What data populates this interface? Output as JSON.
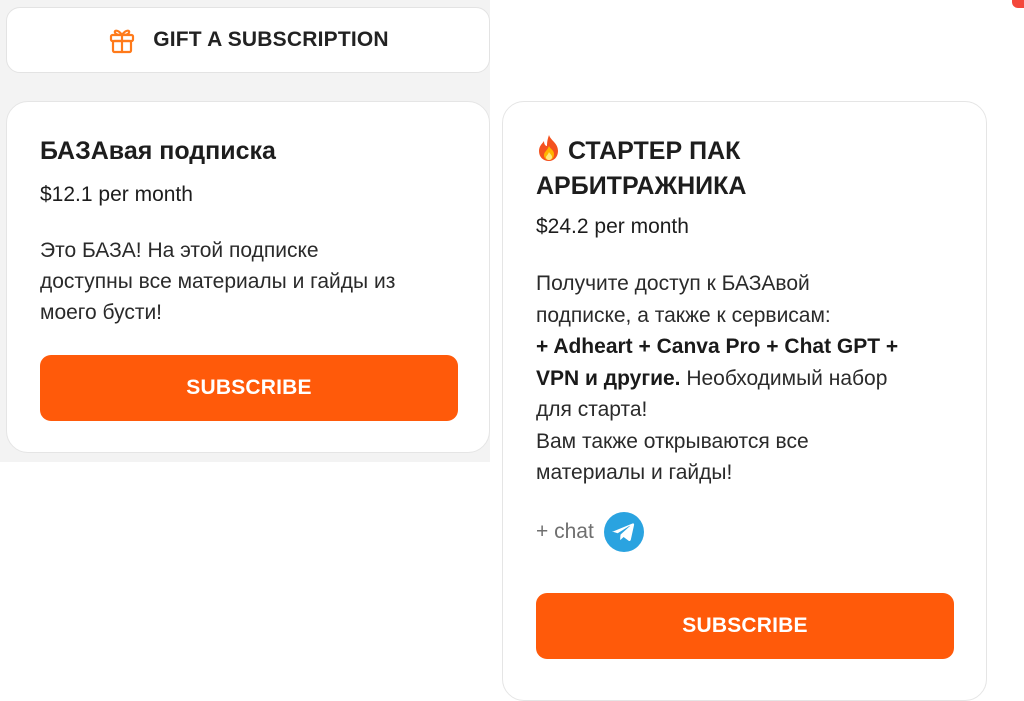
{
  "gift": {
    "label": "GIFT A SUBSCRIPTION",
    "icon": "gift-icon"
  },
  "tiers": [
    {
      "title": "БАЗАвая подписка",
      "price": "$12.1 per month",
      "description_lines": [
        "Это БАЗА! На этой подписке",
        "доступны все материалы и гайды из",
        "моего бусти!"
      ],
      "button_label": "SUBSCRIBE"
    },
    {
      "title_line1": "СТАРТЕР ПАК",
      "title_line2": "АРБИТРАЖНИКА",
      "title_icon": "fire-icon",
      "price": "$24.2 per month",
      "desc_line1": "Получите доступ к БАЗАвой",
      "desc_line2": "подписке, а также к сервисам:",
      "desc_line3_bold": "+ Adheart + Canva Pro + Chat GPT +",
      "desc_line4_bold": "VPN и другие.",
      "desc_line4_rest": " Необходимый набор",
      "desc_line5": "для старта!",
      "desc_line6": "Вам также открываются все",
      "desc_line7": "материалы и гайды!",
      "chat_label": "+ chat",
      "chat_icon": "telegram-icon",
      "button_label": "SUBSCRIBE"
    }
  ],
  "colors": {
    "accent": "#ff5a0a",
    "gift_icon": "#ff7a1a",
    "telegram": "#2aa3e0"
  }
}
